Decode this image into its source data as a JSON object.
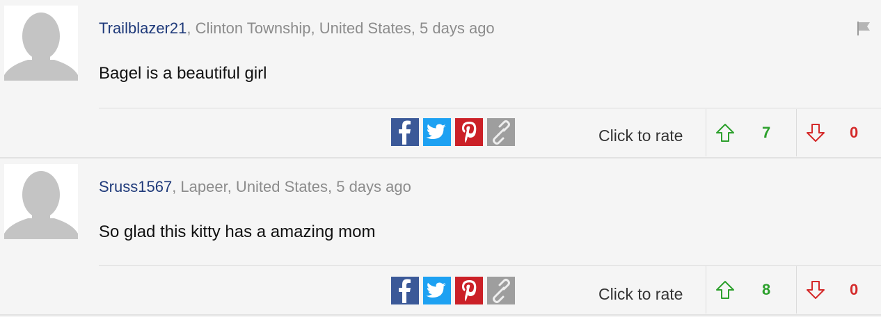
{
  "comments": [
    {
      "username": "Trailblazer21",
      "location_time": ", Clinton Township, United States, 5 days ago",
      "text": "Bagel is a beautiful girl",
      "rate_label": "Click to rate",
      "upvotes": "7",
      "downvotes": "0",
      "show_flag": true
    },
    {
      "username": "Sruss1567",
      "location_time": ", Lapeer, United States, 5 days ago",
      "text": "So glad this kitty has a amazing mom",
      "rate_label": "Click to rate",
      "upvotes": "8",
      "downvotes": "0",
      "show_flag": false
    }
  ],
  "icons": {
    "avatar": "default-avatar-icon",
    "flag": "flag-icon",
    "facebook": "facebook-icon",
    "twitter": "twitter-icon",
    "pinterest": "pinterest-icon",
    "link": "link-icon",
    "up": "arrow-up-icon",
    "down": "arrow-down-icon"
  },
  "colors": {
    "username": "#1f3a7a",
    "upvote": "#2ca02c",
    "downvote": "#d42a2a",
    "facebook": "#3b5998",
    "twitter": "#1da1f2",
    "pinterest": "#cb2027",
    "link": "#9e9e9e"
  }
}
